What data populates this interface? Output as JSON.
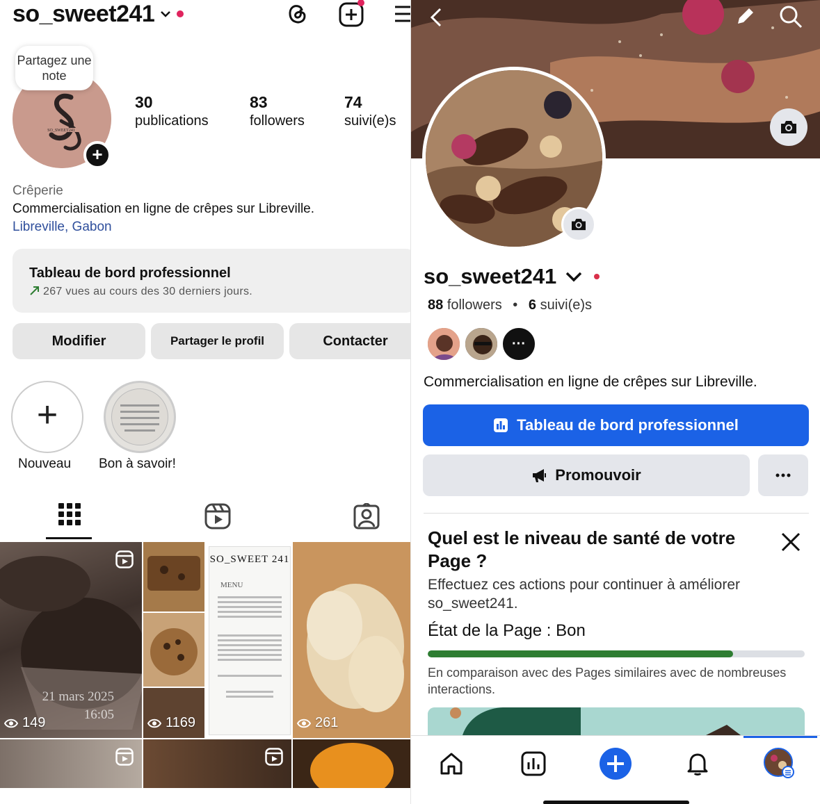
{
  "instagram": {
    "username": "so_sweet241",
    "note_bubble": "Partagez une note",
    "stats": [
      {
        "value": "30",
        "label": "publications"
      },
      {
        "value": "83",
        "label": "followers"
      },
      {
        "value": "74",
        "label": "suivi(e)s"
      }
    ],
    "bio": {
      "category": "Crêperie",
      "text": "Commercialisation en ligne de crêpes sur Libreville.",
      "location": "Libreville, Gabon"
    },
    "dashboard": {
      "title": "Tableau de bord professionnel",
      "subtitle": "267 vues au cours des 30 derniers jours."
    },
    "buttons": {
      "edit": "Modifier",
      "share": "Partager le profil",
      "contact": "Contacter"
    },
    "highlights": [
      {
        "label": "Nouveau"
      },
      {
        "label": "Bon à savoir!"
      }
    ],
    "grid_views": [
      "149",
      "1169",
      "261"
    ],
    "post_date": "21 mars 2025",
    "post_time": "16:05",
    "menu_card": {
      "title": "SO_SWEET 241",
      "heading": "MENU"
    }
  },
  "facebook": {
    "username": "so_sweet241",
    "followers_count": "88",
    "followers_label": "followers",
    "following_count": "6",
    "following_label": "suivi(e)s",
    "bio": "Commercialisation en ligne de crêpes sur Libreville.",
    "dashboard_button": "Tableau de bord professionnel",
    "promote_button": "Promouvoir",
    "health": {
      "title": "Quel est le niveau de santé de votre Page ?",
      "description": "Effectuez ces actions pour continuer à améliorer so_sweet241.",
      "state": "État de la Page : Bon",
      "progress": 0.81,
      "comparison": "En comparaison avec des Pages similaires avec de nombreuses interactions."
    },
    "colors": {
      "primary": "#1b62e6",
      "progress": "#2e7d32",
      "red_dot": "#e0245e"
    }
  }
}
